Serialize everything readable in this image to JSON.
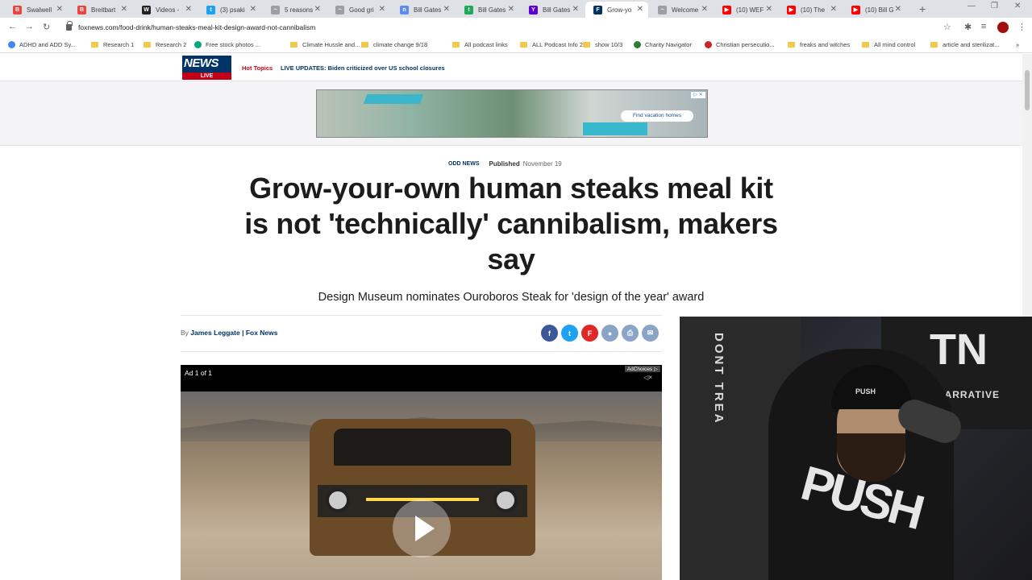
{
  "browser": {
    "tabs": [
      {
        "label": "Swalwell",
        "color": "#e8453c",
        "glyph": "B"
      },
      {
        "label": "Breitbart",
        "color": "#e8453c",
        "glyph": "B"
      },
      {
        "label": "Videos -",
        "color": "#222222",
        "glyph": "W"
      },
      {
        "label": "(3) psaki",
        "color": "#1da1f2",
        "glyph": "t"
      },
      {
        "label": "5 reasons",
        "color": "#9aa0a6",
        "glyph": "~"
      },
      {
        "label": "Good gri",
        "color": "#9aa0a6",
        "glyph": "~"
      },
      {
        "label": "Bill Gates",
        "color": "#5a8dee",
        "glyph": "n"
      },
      {
        "label": "Bill Gates",
        "color": "#1faa59",
        "glyph": "t"
      },
      {
        "label": "Bill Gates",
        "color": "#6001d2",
        "glyph": "Y"
      },
      {
        "label": "Grow-yo",
        "color": "#003366",
        "glyph": "F",
        "active": true
      },
      {
        "label": "Welcome",
        "color": "#9aa0a6",
        "glyph": "~"
      },
      {
        "label": "(10) WEF",
        "color": "#ff0000",
        "glyph": "▶"
      },
      {
        "label": "(10) The",
        "color": "#ff0000",
        "glyph": "▶"
      },
      {
        "label": "(10) Bill G",
        "color": "#ff0000",
        "glyph": "▶"
      }
    ],
    "url": "foxnews.com/food-drink/human-steaks-meal-kit-design-award-not-cannibalism",
    "bookmarks": [
      {
        "label": "ADHD and ADD Sy...",
        "kind": "google"
      },
      {
        "label": "Research 1",
        "kind": "folder"
      },
      {
        "label": "Research 2",
        "kind": "folder"
      },
      {
        "label": "Free stock photos ...",
        "kind": "site"
      },
      {
        "label": "Climate Hussle and...",
        "kind": "folder"
      },
      {
        "label": "climate change 9/18",
        "kind": "folder"
      },
      {
        "label": "All podcast links",
        "kind": "folder"
      },
      {
        "label": "ALL Podcast Info 2",
        "kind": "folder"
      },
      {
        "label": "show 10/3",
        "kind": "folder"
      },
      {
        "label": "Charity Navigator",
        "kind": "site"
      },
      {
        "label": "Christian persecutio...",
        "kind": "site"
      },
      {
        "label": "freaks and witches",
        "kind": "folder"
      },
      {
        "label": "All mind control",
        "kind": "folder"
      },
      {
        "label": "article and sterilizat...",
        "kind": "folder"
      }
    ]
  },
  "site": {
    "logo_text": "NEWS",
    "logo_live": "LIVE",
    "hot_topics": "Hot Topics",
    "live_update": "LIVE UPDATES: Biden criticized over US school closures",
    "ad_button": "Find vacation homes",
    "ad_close": "▷ ✕"
  },
  "article": {
    "category": "ODD NEWS",
    "published_label": "Published",
    "published_date": "November 19",
    "headline": "Grow-your-own human steaks meal kit is not 'technically' cannibalism, makers say",
    "subhead": "Design Museum nominates Ouroboros Steak for 'design of the year' award",
    "byline_prefix": "By",
    "byline_author": "James Leggate | Fox News",
    "share_icons": [
      {
        "name": "facebook-icon",
        "glyph": "f",
        "color": "#3b5998"
      },
      {
        "name": "twitter-icon",
        "glyph": "t",
        "color": "#1da1f2"
      },
      {
        "name": "flipboard-icon",
        "glyph": "F",
        "color": "#e12828"
      },
      {
        "name": "comments-icon",
        "glyph": "●",
        "color": "#8aa4c8"
      },
      {
        "name": "print-icon",
        "glyph": "⎙",
        "color": "#8aa4c8"
      },
      {
        "name": "email-icon",
        "glyph": "✉",
        "color": "#8aa4c8"
      }
    ]
  },
  "video": {
    "ad_counter": "Ad 1 of 1",
    "adchoices": "AdChoices ▷",
    "mute_glyph": "◁×"
  },
  "webcam": {
    "flag_text": "DONT TREA",
    "poster_text": "TN",
    "poster_sub": "RAVEL NARRATIVE",
    "beanie_text": "PUSH",
    "hoodie_text": "PUSH"
  }
}
